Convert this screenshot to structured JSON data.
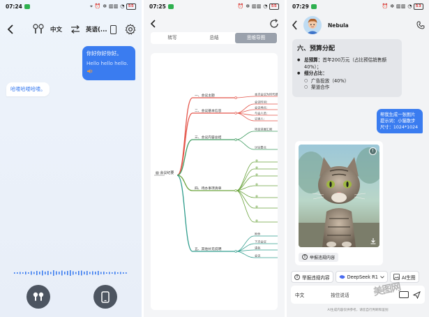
{
  "panel1": {
    "status": {
      "time": "07:24",
      "icons": "⌖ ⏰ ✲ ▥▥ ◔",
      "battery": "55"
    },
    "header": {
      "lang_source": "中文",
      "lang_target": "英语(..."
    },
    "messages": [
      {
        "side": "right",
        "line1": "你好你好你好。",
        "line2": "Hello hello hello."
      },
      {
        "side": "left",
        "line1": "哈喽哈喽哈喽。"
      }
    ]
  },
  "panel2": {
    "status": {
      "time": "07:25",
      "icons": "⏰ ✲ ▥▥ ◔",
      "battery": "55"
    },
    "tabs": [
      {
        "label": "转写",
        "active": false
      },
      {
        "label": "总结",
        "active": false
      },
      {
        "label": "思维导图",
        "active": true
      }
    ],
    "mindmap": {
      "root": "会议纪要",
      "branches": [
        {
          "label": "一、会议主题",
          "color": "#e4554a",
          "leaves": [
            "本次会议为时代感相"
          ]
        },
        {
          "label": "二、会议基本信息",
          "color": "#e4554a",
          "leaves": [
            "会议时间：",
            "会议地点：",
            "与会人员：",
            "记录人："
          ]
        },
        {
          "label": "三、会议内容总结",
          "color": "#3c9a5f",
          "leaves": [
            "项目进展汇报",
            "讨论要点"
          ]
        },
        {
          "label": "四、待办事项清单",
          "color": "#6aa33c",
          "leaves": [
            "",
            "",
            "",
            "",
            "",
            "",
            ""
          ]
        },
        {
          "label": "五、其他补充说明",
          "color": "#2e9c8c",
          "leaves": [
            "附件",
            "下次会议",
            "请各",
            "会议"
          ]
        }
      ]
    }
  },
  "panel3": {
    "status": {
      "time": "07:29",
      "icons": "⏰ ✲ ▥▥ ◔",
      "battery": "53"
    },
    "header": {
      "name": "Nebula"
    },
    "card": {
      "title": "六、预算分配",
      "rows": [
        {
          "level": 1,
          "bold": "总预算：",
          "text": "首年200万元（占比预估销售额 40%）；"
        },
        {
          "level": 1,
          "bold": "细分占比：",
          "text": ""
        },
        {
          "level": 2,
          "bold": "",
          "text": "广告投放（40%）"
        },
        {
          "level": 2,
          "bold": "",
          "text": "渠道合作"
        }
      ]
    },
    "request": {
      "line1": "帮我生成一张图片",
      "line2": "提示词：小猫散步",
      "line3": "尺寸：1024*1024"
    },
    "image_card": {
      "report_label": "举报违规内容"
    },
    "actions": {
      "report": "举报违规内容",
      "model": "DeepSeek R1",
      "ai_image": "AI生图"
    },
    "input": {
      "lang": "中文",
      "placeholder": "按住说话"
    },
    "disclaimer": "AI生成内容仅供参考，请您自行判断和鉴别",
    "watermark": "美图网"
  }
}
